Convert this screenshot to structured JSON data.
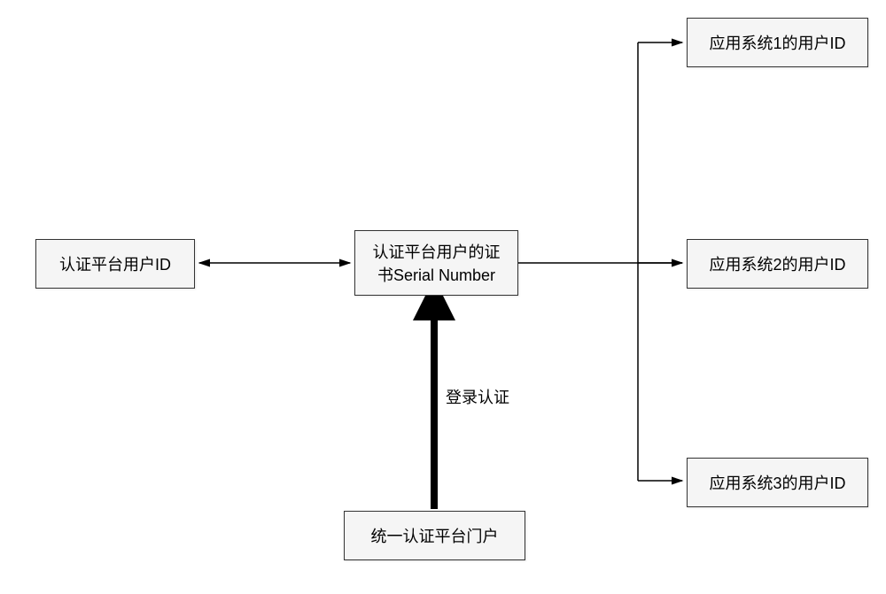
{
  "boxes": {
    "left": "认证平台用户ID",
    "center": "认证平台用户的证\n书Serial Number",
    "bottom": "统一认证平台门户",
    "r1": "应用系统1的用户ID",
    "r2": "应用系统2的用户ID",
    "r3": "应用系统3的用户ID"
  },
  "labels": {
    "loginAuth": "登录认证"
  }
}
